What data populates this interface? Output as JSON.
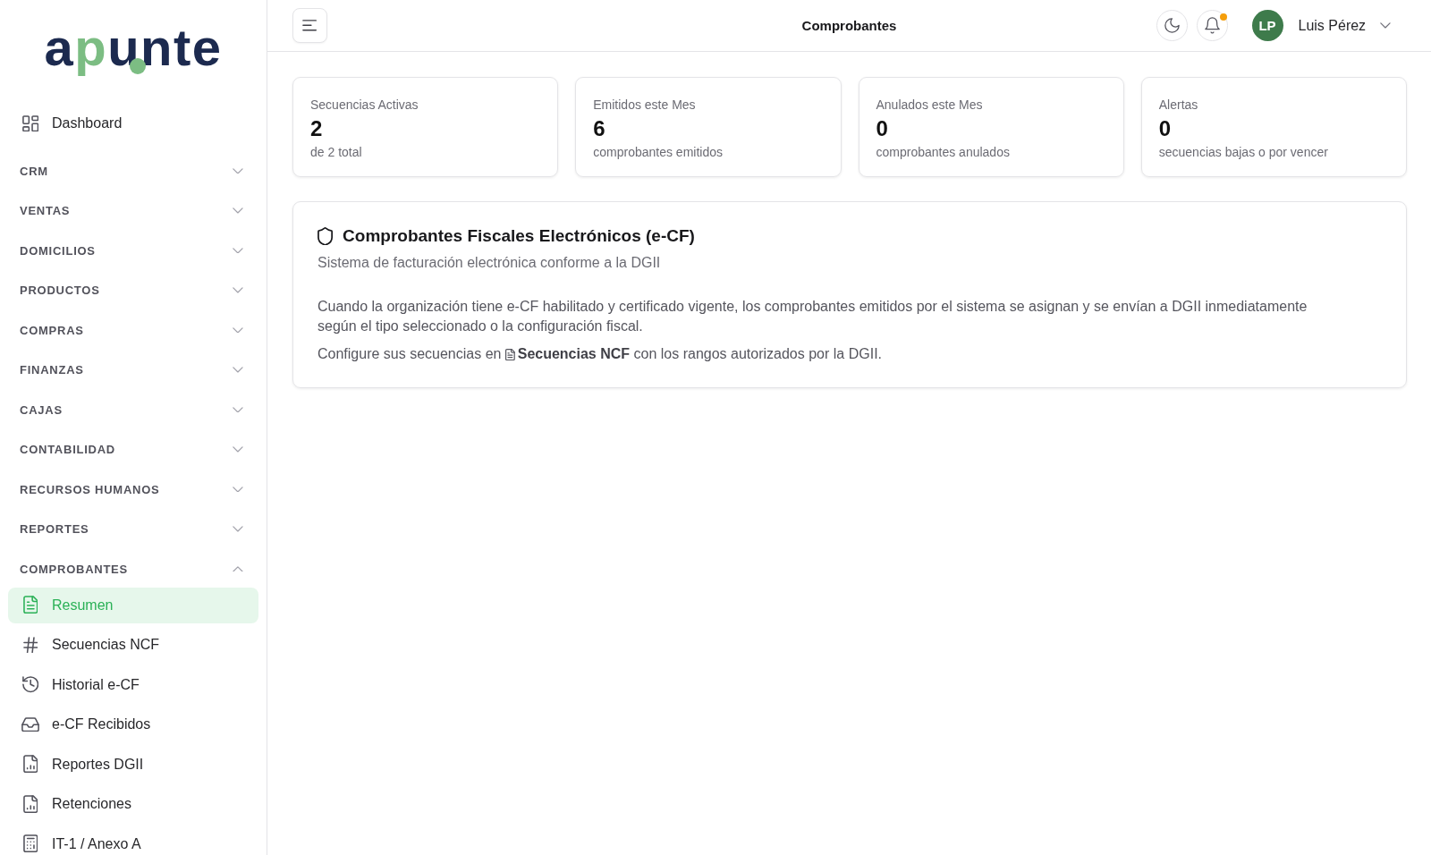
{
  "sidebar": {
    "logo": "apunte",
    "items": [
      {
        "label": "Dashboard",
        "selected": false
      }
    ],
    "sections": [
      {
        "label": "CRM",
        "expanded": false
      },
      {
        "label": "VENTAS",
        "expanded": false
      },
      {
        "label": "DOMICILIOS",
        "expanded": false
      },
      {
        "label": "PRODUCTOS",
        "expanded": false
      },
      {
        "label": "COMPRAS",
        "expanded": false
      },
      {
        "label": "FINANZAS",
        "expanded": false
      },
      {
        "label": "CAJAS",
        "expanded": false
      },
      {
        "label": "CONTABILIDAD",
        "expanded": false
      },
      {
        "label": "RECURSOS HUMANOS",
        "expanded": false
      },
      {
        "label": "REPORTES",
        "expanded": false
      },
      {
        "label": "COMPROBANTES",
        "expanded": true,
        "children": [
          {
            "label": "Resumen",
            "selected": true
          },
          {
            "label": "Secuencias NCF",
            "selected": false
          },
          {
            "label": "Historial e-CF",
            "selected": false
          },
          {
            "label": "e-CF Recibidos",
            "selected": false
          },
          {
            "label": "Reportes DGII",
            "selected": false
          },
          {
            "label": "Retenciones",
            "selected": false
          },
          {
            "label": "IT-1 / Anexo A",
            "selected": false
          }
        ]
      }
    ]
  },
  "topbar": {
    "title": "Comprobantes",
    "notifications": {
      "unread": true
    },
    "user": {
      "initials": "LP",
      "name": "Luis Pérez"
    }
  },
  "stats": [
    {
      "label": "Secuencias Activas",
      "value": "2",
      "caption": "de 2 total"
    },
    {
      "label": "Emitidos este Mes",
      "value": "6",
      "caption": "comprobantes emitidos"
    },
    {
      "label": "Anulados este Mes",
      "value": "0",
      "caption": "comprobantes anulados"
    },
    {
      "label": "Alertas",
      "value": "0",
      "caption": "secuencias bajas o por vencer"
    }
  ],
  "panel": {
    "title": "Comprobantes Fiscales Electrónicos (e-CF)",
    "subtitle": "Sistema de facturación electrónica conforme a la DGII",
    "body": "Cuando la organización tiene e-CF habilitado y certificado vigente, los comprobantes emitidos por el sistema se asignan y se envían a DGII inmediatamente según el tipo seleccionado o la configuración fiscal.",
    "note": {
      "before": "Configure sus secuencias en",
      "link": "Secuencias NCF",
      "after": "con los rangos autorizados por la DGII."
    }
  }
}
